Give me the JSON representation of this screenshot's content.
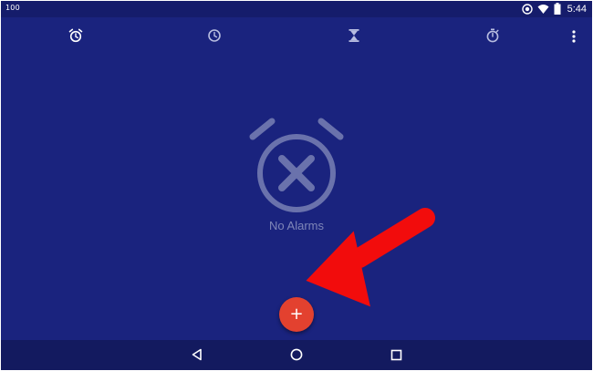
{
  "statusbar": {
    "left_text": "100",
    "time": "5:44",
    "icons": [
      "sync-icon",
      "wifi-icon",
      "battery-icon"
    ]
  },
  "toolbar": {
    "tabs": [
      {
        "id": "alarm",
        "icon": "alarm-clock-icon",
        "selected": true
      },
      {
        "id": "clock",
        "icon": "clock-icon",
        "selected": false
      },
      {
        "id": "timer",
        "icon": "hourglass-icon",
        "selected": false
      },
      {
        "id": "stopwatch",
        "icon": "stopwatch-icon",
        "selected": false
      }
    ],
    "overflow_icon": "more-vert-icon"
  },
  "main": {
    "empty_icon": "alarm-off-icon",
    "empty_label": "No Alarms"
  },
  "fab": {
    "label": "+",
    "color": "#e3412f"
  },
  "navbar": {
    "buttons": [
      "back-icon",
      "home-icon",
      "recents-icon"
    ]
  },
  "colors": {
    "background": "#1a237e",
    "statusbar": "#151c6b",
    "navbar": "#131a5f",
    "arrow": "#f20c0c"
  }
}
